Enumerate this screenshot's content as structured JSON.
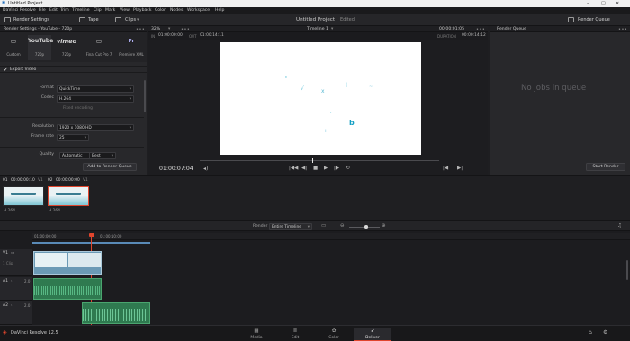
{
  "window": {
    "title": "Untitled Project",
    "controls": [
      "–",
      "□",
      "✕"
    ]
  },
  "menu": [
    "DaVinci Resolve",
    "File",
    "Edit",
    "Trim",
    "Timeline",
    "Clip",
    "Mark",
    "View",
    "Playback",
    "Color",
    "Nodes",
    "Workspace",
    "Help"
  ],
  "toolbar": {
    "render_settings": "Render Settings",
    "tape": "Tape",
    "clips": "Clips",
    "project_title": "Untitled Project",
    "project_status": "Edited",
    "render_queue": "Render Queue"
  },
  "render_panel": {
    "title": "Render Settings - YouTube - 720p",
    "presets": [
      {
        "logo": "▭",
        "label": "Custom"
      },
      {
        "logo": "YouTube",
        "label": "720p"
      },
      {
        "logo": "vimeo",
        "label": "720p"
      },
      {
        "logo": "▭",
        "label": "Final Cut Pro 7"
      },
      {
        "logo": "Pr",
        "label": "Premiere XML"
      }
    ],
    "export_video": "Export Video",
    "format_label": "Format",
    "format_value": "QuickTime",
    "codec_label": "Codec",
    "codec_value": "H.264",
    "encoding_label": "Fixed encoding",
    "resolution_label": "Resolution",
    "resolution_value": "1920 x 1080 HD",
    "framerate_label": "Frame rate",
    "framerate_value": "25",
    "quality_label": "Quality",
    "quality_mode": "Automatic",
    "quality_value": "Best",
    "add_button": "Add to Render Queue"
  },
  "viewer": {
    "zoom": "32%",
    "timeline_name": "Timeline 1",
    "timecode_top": "00:00:01:05",
    "in_label": "IN",
    "in_value": "01:00:00:00",
    "out_label": "OUT",
    "out_value": "01:00:14:11",
    "duration_label": "DURATION",
    "duration_value": "00:00:14:12",
    "current_timecode": "01:00:07:04"
  },
  "queue": {
    "title": "Render Queue",
    "empty_text": "No jobs in queue",
    "start_button": "Start Render"
  },
  "clips": [
    {
      "index": "01",
      "timecode": "00:00:00:10",
      "track": "V1",
      "codec": "H.264"
    },
    {
      "index": "02",
      "timecode": "00:00:00:00",
      "track": "V1",
      "codec": "H.264"
    }
  ],
  "timeline_bar": {
    "render_label": "Render",
    "render_value": "Entire Timeline"
  },
  "tracks": [
    {
      "name": "V1",
      "sub": "1 Clip"
    },
    {
      "name": "A1",
      "sub": "2.0"
    },
    {
      "name": "A2",
      "sub": "2.0"
    }
  ],
  "timeline_times": [
    "01:00:00:00",
    "01:00:10:00"
  ],
  "bottom": {
    "app_name": "DaVinci Resolve 12.5",
    "pages": [
      {
        "icon": "media",
        "label": "Media"
      },
      {
        "icon": "edit",
        "label": "Edit"
      },
      {
        "icon": "color",
        "label": "Color"
      },
      {
        "icon": "deliver",
        "label": "Deliver"
      }
    ]
  },
  "colors": {
    "accent": "#e0452d",
    "video_clip": "#6b9ab5",
    "audio_clip": "#2f7a50"
  },
  "playback": {
    "progress": 0.47
  }
}
